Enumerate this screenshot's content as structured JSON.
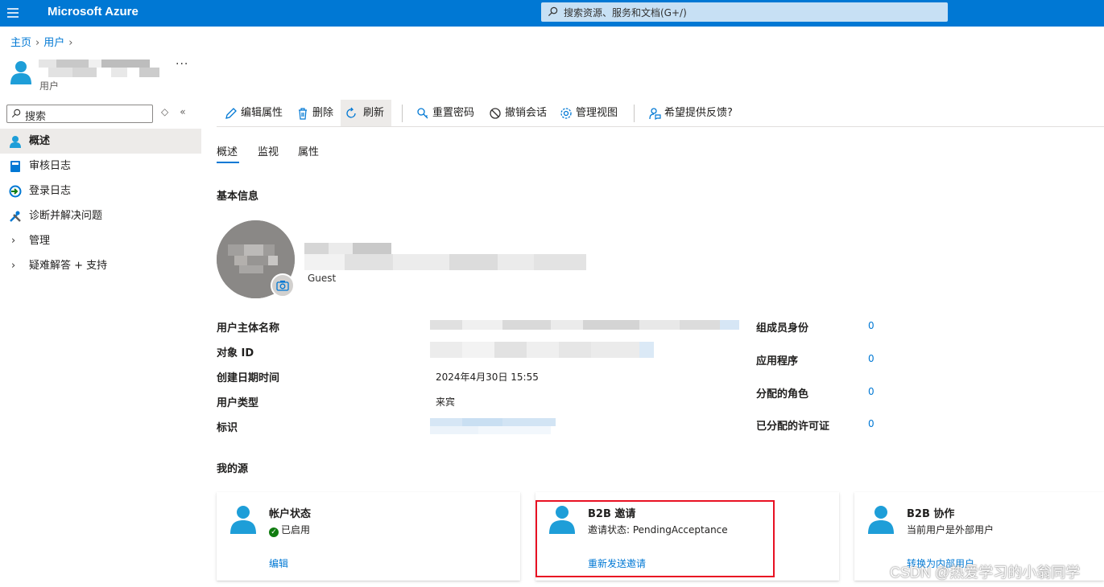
{
  "topbar": {
    "brand": "Microsoft Azure",
    "search_placeholder": "搜索资源、服务和文档(G+/)"
  },
  "breadcrumb": {
    "home": "主页",
    "users": "用户"
  },
  "header": {
    "more": "···",
    "subtitle": "用户"
  },
  "nav": {
    "search_placeholder": "搜索",
    "items": [
      {
        "label": "概述"
      },
      {
        "label": "审核日志"
      },
      {
        "label": "登录日志"
      },
      {
        "label": "诊断并解决问题"
      },
      {
        "label": "管理"
      },
      {
        "label": "疑难解答 + 支持"
      }
    ]
  },
  "toolbar": {
    "edit": "编辑属性",
    "delete": "删除",
    "refresh": "刷新",
    "reset_password": "重置密码",
    "revoke_sessions": "撤销会话",
    "manage_view": "管理视图",
    "feedback": "希望提供反馈?"
  },
  "tabs": [
    {
      "label": "概述"
    },
    {
      "label": "监视"
    },
    {
      "label": "属性"
    }
  ],
  "basic_info": {
    "title": "基本信息",
    "user_type_badge": "Guest",
    "properties": [
      {
        "label": "用户主体名称",
        "value": ""
      },
      {
        "label": "对象 ID",
        "value": ""
      },
      {
        "label": "创建日期时间",
        "value": "2024年4月30日 15:55"
      },
      {
        "label": "用户类型",
        "value": "来宾"
      },
      {
        "label": "标识",
        "value": ""
      }
    ],
    "stats": [
      {
        "label": "组成员身份",
        "value": "0"
      },
      {
        "label": "应用程序",
        "value": "0"
      },
      {
        "label": "分配的角色",
        "value": "0"
      },
      {
        "label": "已分配的许可证",
        "value": "0"
      }
    ]
  },
  "my_sources": {
    "title": "我的源",
    "cards": [
      {
        "title": "帐户状态",
        "desc": "已启用",
        "link": "编辑"
      },
      {
        "title": "B2B 邀请",
        "desc": "邀请状态: PendingAcceptance",
        "link": "重新发送邀请"
      },
      {
        "title": "B2B 协作",
        "desc": "当前用户是外部用户",
        "link": "转换为内部用户"
      }
    ]
  },
  "watermark": "CSDN @热爱学习的小翁同学",
  "colors": {
    "accent": "#0078d4",
    "highlight_box": "#e81123",
    "enabled": "#107c10"
  }
}
